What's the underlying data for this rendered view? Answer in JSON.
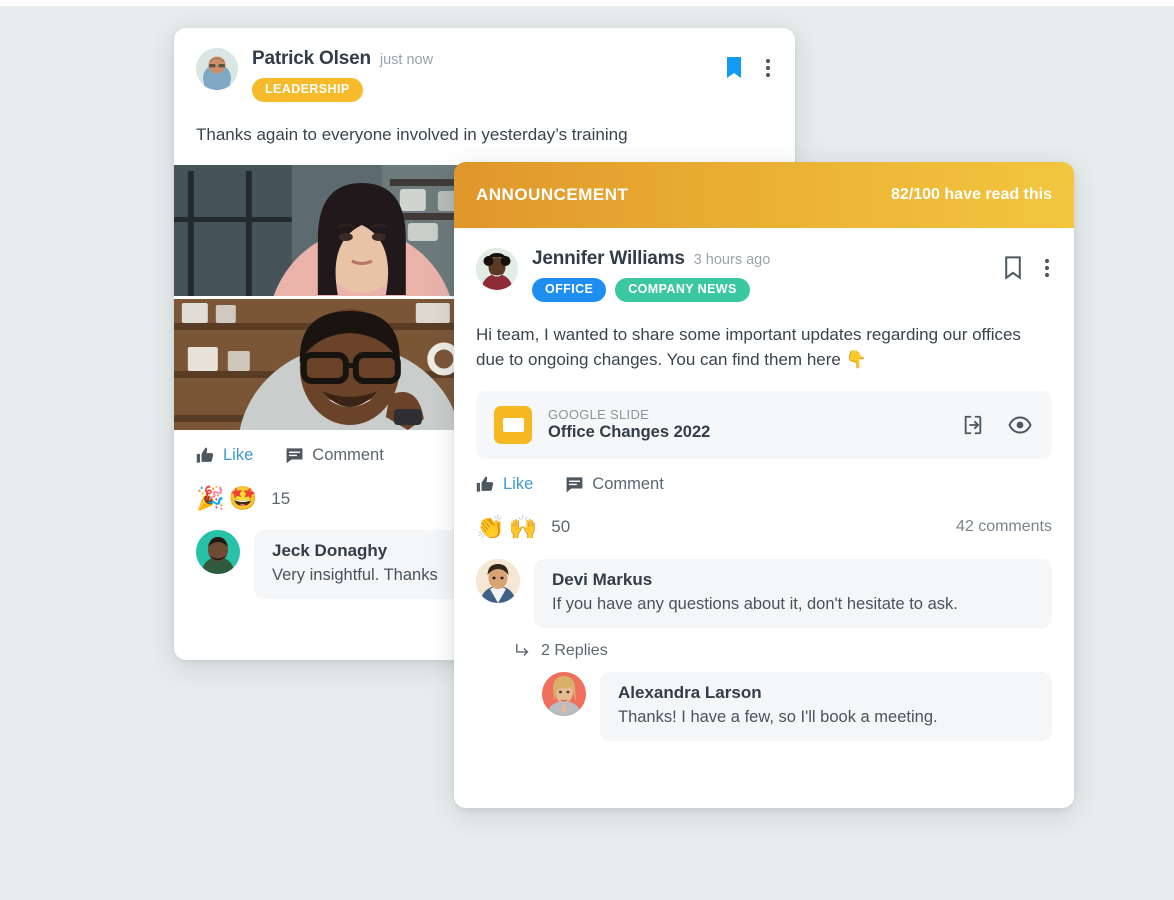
{
  "background_color": "#e7ecec",
  "back_post": {
    "author": "Patrick Olsen",
    "timestamp": "just now",
    "tags": [
      {
        "label": "LEADERSHIP",
        "color": "#f5bb2a"
      }
    ],
    "body": "Thanks again to everyone involved in yesterday’s training",
    "bookmark_icon": "bookmark-filled-icon",
    "bookmark_color": "#129bf2",
    "more_icon": "more-vertical-icon",
    "actions": {
      "like_label": "Like",
      "like_icon": "thumb-up-icon",
      "comment_label": "Comment",
      "comment_icon": "comment-icon"
    },
    "reactions": {
      "emojis": [
        "🎉",
        "🤩"
      ],
      "count": "15"
    },
    "comment": {
      "author": "Jeck Donaghy",
      "text": "Very insightful. Thanks"
    }
  },
  "front_post": {
    "banner": {
      "label": "ANNOUNCEMENT",
      "read_status": "82/100 have read this",
      "gradient_from": "#e0962a",
      "gradient_to": "#f3c63e"
    },
    "author": "Jennifer Williams",
    "timestamp": "3 hours ago",
    "tags": [
      {
        "label": "OFFICE",
        "color": "#1f8ef1"
      },
      {
        "label": "COMPANY NEWS",
        "color": "#3bc8a0"
      }
    ],
    "bookmark_icon": "bookmark-outline-icon",
    "more_icon": "more-vertical-icon",
    "body": "Hi team, I wanted to share some important updates regarding our offices due to ongoing changes. You can find them here 👇",
    "attachment": {
      "icon": "google-slide-icon",
      "icon_color": "#f5b722",
      "kind": "GOOGLE SLIDE",
      "name": "Office Changes 2022",
      "open_icon": "open-in-icon",
      "preview_icon": "eye-icon"
    },
    "actions": {
      "like_label": "Like",
      "like_icon": "thumb-up-icon",
      "comment_label": "Comment",
      "comment_icon": "comment-icon"
    },
    "reactions": {
      "emojis": [
        "👏",
        "🙌"
      ],
      "count": "50",
      "comments_label": "42 comments"
    },
    "comments": [
      {
        "author": "Devi Markus",
        "text": "If you have any questions about it, don't hesitate to ask."
      }
    ],
    "replies": {
      "icon": "reply-arrow-icon",
      "label": "2 Replies",
      "items": [
        {
          "author": "Alexandra Larson",
          "text": "Thanks! I have a few, so I'll book a meeting."
        }
      ]
    }
  }
}
